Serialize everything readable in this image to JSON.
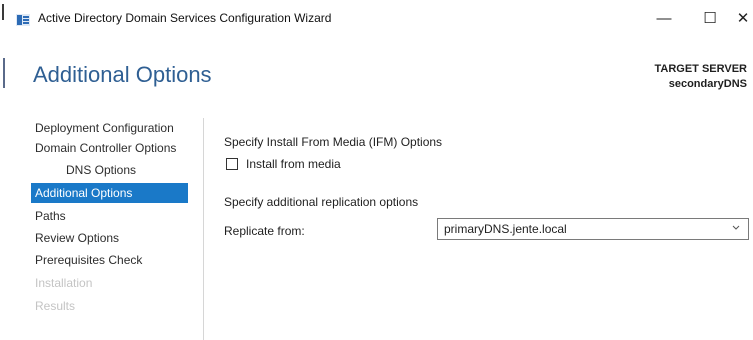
{
  "window": {
    "title": "Active Directory Domain Services Configuration Wizard",
    "minimize_glyph": "—",
    "maximize_glyph": "☐",
    "close_glyph": "✕"
  },
  "header": {
    "page_title": "Additional Options",
    "target_label": "TARGET SERVER",
    "target_name": "secondaryDNS"
  },
  "sidebar": {
    "items": [
      {
        "label": "Deployment Configuration",
        "state": "normal"
      },
      {
        "label": "Domain Controller Options",
        "state": "normal"
      },
      {
        "label": "DNS Options",
        "state": "normal"
      },
      {
        "label": "Additional Options",
        "state": "active"
      },
      {
        "label": "Paths",
        "state": "normal"
      },
      {
        "label": "Review Options",
        "state": "normal"
      },
      {
        "label": "Prerequisites Check",
        "state": "normal"
      },
      {
        "label": "Installation",
        "state": "disabled"
      },
      {
        "label": "Results",
        "state": "disabled"
      }
    ]
  },
  "main": {
    "ifm_heading": "Specify Install From Media (IFM) Options",
    "install_from_media_label": "Install from media",
    "install_from_media_checked": false,
    "replication_heading": "Specify additional replication options",
    "replicate_from_label": "Replicate from:",
    "replicate_from_value": "primaryDNS.jente.local"
  },
  "colors": {
    "heading": "#2f5f93",
    "active_nav": "#1a79c8",
    "disabled_nav": "#c4c4c4"
  },
  "icons": {
    "app": "server-manager-icon",
    "dropdown": "chevron-down-icon"
  }
}
